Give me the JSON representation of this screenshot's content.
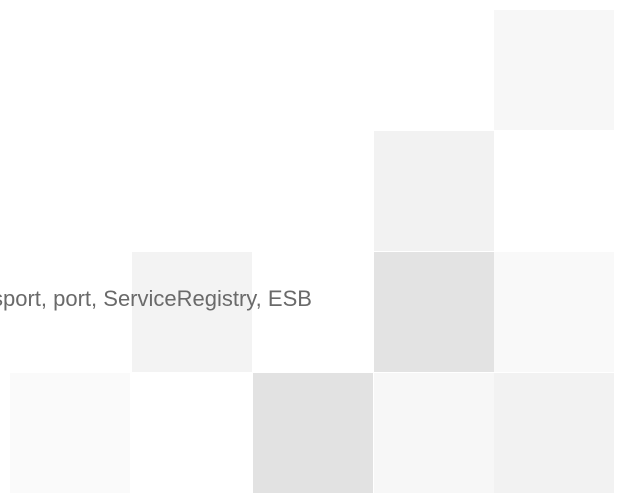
{
  "keywords_text": "sport, port, ServiceRegistry, ESB",
  "tile_colors": {
    "t1": "#f7f7f7",
    "t2": "#f2f2f2",
    "t3": "#f3f3f3",
    "t4": "#e3e3e3",
    "t5": "#f9f9f9",
    "t6": "#fafafa",
    "t7": "#e2e2e2",
    "t8": "#f7f7f7",
    "t9": "#f2f2f2"
  }
}
